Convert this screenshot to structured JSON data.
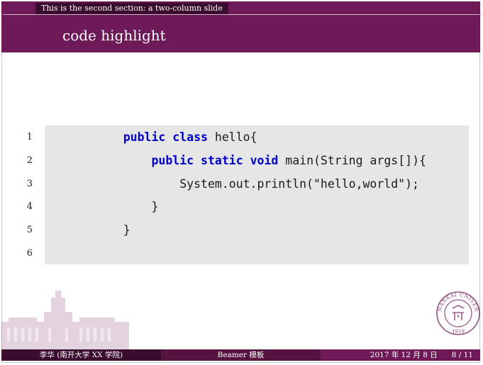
{
  "header": {
    "section": "This is the second section: a two-column slide",
    "title": "code highlight"
  },
  "code": {
    "lines": [
      {
        "number": "1",
        "indent": "    ",
        "tokens": [
          {
            "t": "public",
            "kw": true
          },
          {
            "t": " ",
            "kw": false
          },
          {
            "t": "class",
            "kw": true
          },
          {
            "t": " hello{",
            "kw": false
          }
        ]
      },
      {
        "number": "2",
        "indent": "        ",
        "tokens": [
          {
            "t": "public",
            "kw": true
          },
          {
            "t": " ",
            "kw": false
          },
          {
            "t": "static",
            "kw": true
          },
          {
            "t": " ",
            "kw": false
          },
          {
            "t": "void",
            "kw": true
          },
          {
            "t": " main(String args[]){",
            "kw": false
          }
        ]
      },
      {
        "number": "3",
        "indent": "            ",
        "tokens": [
          {
            "t": "System.out.println(\"hello,world\");",
            "kw": false
          }
        ]
      },
      {
        "number": "4",
        "indent": "        ",
        "tokens": [
          {
            "t": "}",
            "kw": false
          }
        ]
      },
      {
        "number": "5",
        "indent": "    ",
        "tokens": [
          {
            "t": "}",
            "kw": false
          }
        ]
      },
      {
        "number": "6",
        "indent": "",
        "tokens": []
      }
    ]
  },
  "footer": {
    "author": "李华 (南开大学 XX 学院)",
    "short_title": "Beamer 模板",
    "date": "2017 年 12 月 8 日",
    "page": "8 / 11"
  },
  "logo": {
    "text": "NANKAI UNIVERSITY",
    "year": "1919"
  },
  "colors": {
    "theme": "#6f1a58",
    "dark": "#3a0c2e",
    "keyword": "#0000cc",
    "code_bg": "#e6e6e6"
  }
}
